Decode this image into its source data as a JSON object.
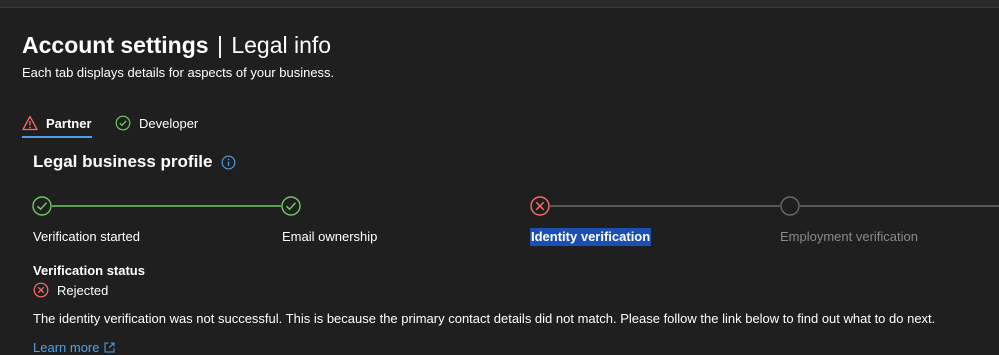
{
  "header": {
    "title_main": "Account settings",
    "title_sep": "|",
    "title_sub": "Legal info",
    "subtitle": "Each tab displays details for aspects of your business."
  },
  "tabs": [
    {
      "label": "Partner",
      "icon": "warning-icon",
      "status": "warning",
      "active": true
    },
    {
      "label": "Developer",
      "icon": "check-circle-icon",
      "status": "ok",
      "active": false
    }
  ],
  "section": {
    "title": "Legal business profile",
    "info_icon": "info-icon"
  },
  "steps": [
    {
      "label": "Verification started",
      "state": "done"
    },
    {
      "label": "Email ownership",
      "state": "done"
    },
    {
      "label": "Identity verification",
      "state": "failed"
    },
    {
      "label": "Employment verification",
      "state": "pending"
    }
  ],
  "status": {
    "heading": "Verification status",
    "value": "Rejected",
    "icon": "error-circle-icon"
  },
  "message": "The identity verification was not successful. This is because the primary contact details did not match. Please follow the link below to find out what to do next.",
  "learn_more": {
    "label": "Learn more",
    "icon": "external-link-icon"
  },
  "colors": {
    "background": "#1f1f1f",
    "success": "#6ccb5f",
    "error": "#ff6b6b",
    "warning": "#ff6b6b",
    "accent": "#4ea1e8",
    "pending": "#8a8a8a",
    "highlight": "#1b4fb3"
  }
}
